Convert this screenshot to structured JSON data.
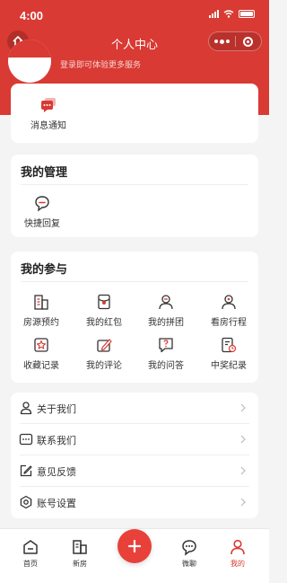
{
  "status_bar": {
    "time": "4:00"
  },
  "nav": {
    "title": "个人中心"
  },
  "profile": {
    "login_hint": "登录即可体验更多服务"
  },
  "messages": {
    "label": "消息通知",
    "icon": "chat-bubble-icon"
  },
  "management": {
    "title": "我的管理",
    "items": [
      {
        "label": "快捷回复",
        "icon": "quick-reply-icon"
      }
    ]
  },
  "participation": {
    "title": "我的参与",
    "items": [
      {
        "label": "房源预约",
        "icon": "building-icon"
      },
      {
        "label": "我的红包",
        "icon": "red-packet-icon"
      },
      {
        "label": "我的拼团",
        "icon": "group-icon"
      },
      {
        "label": "看房行程",
        "icon": "itinerary-icon"
      },
      {
        "label": "收藏记录",
        "icon": "star-icon"
      },
      {
        "label": "我的评论",
        "icon": "comment-icon"
      },
      {
        "label": "我的问答",
        "icon": "question-icon"
      },
      {
        "label": "中奖纪录",
        "icon": "prize-icon"
      }
    ]
  },
  "list": [
    {
      "label": "关于我们",
      "icon": "user-icon"
    },
    {
      "label": "联系我们",
      "icon": "chat-dots-icon"
    },
    {
      "label": "意见反馈",
      "icon": "edit-icon"
    },
    {
      "label": "账号设置",
      "icon": "settings-icon"
    }
  ],
  "tabbar": [
    {
      "label": "首页",
      "icon": "home-icon"
    },
    {
      "label": "新房",
      "icon": "building-icon"
    },
    {
      "label": "",
      "icon": "plus-icon"
    },
    {
      "label": "微聊",
      "icon": "chat-icon"
    },
    {
      "label": "我的",
      "icon": "person-icon",
      "active": true
    }
  ],
  "colors": {
    "brand": "#d93a33",
    "background": "#f4f4f4",
    "text": "#333333"
  }
}
